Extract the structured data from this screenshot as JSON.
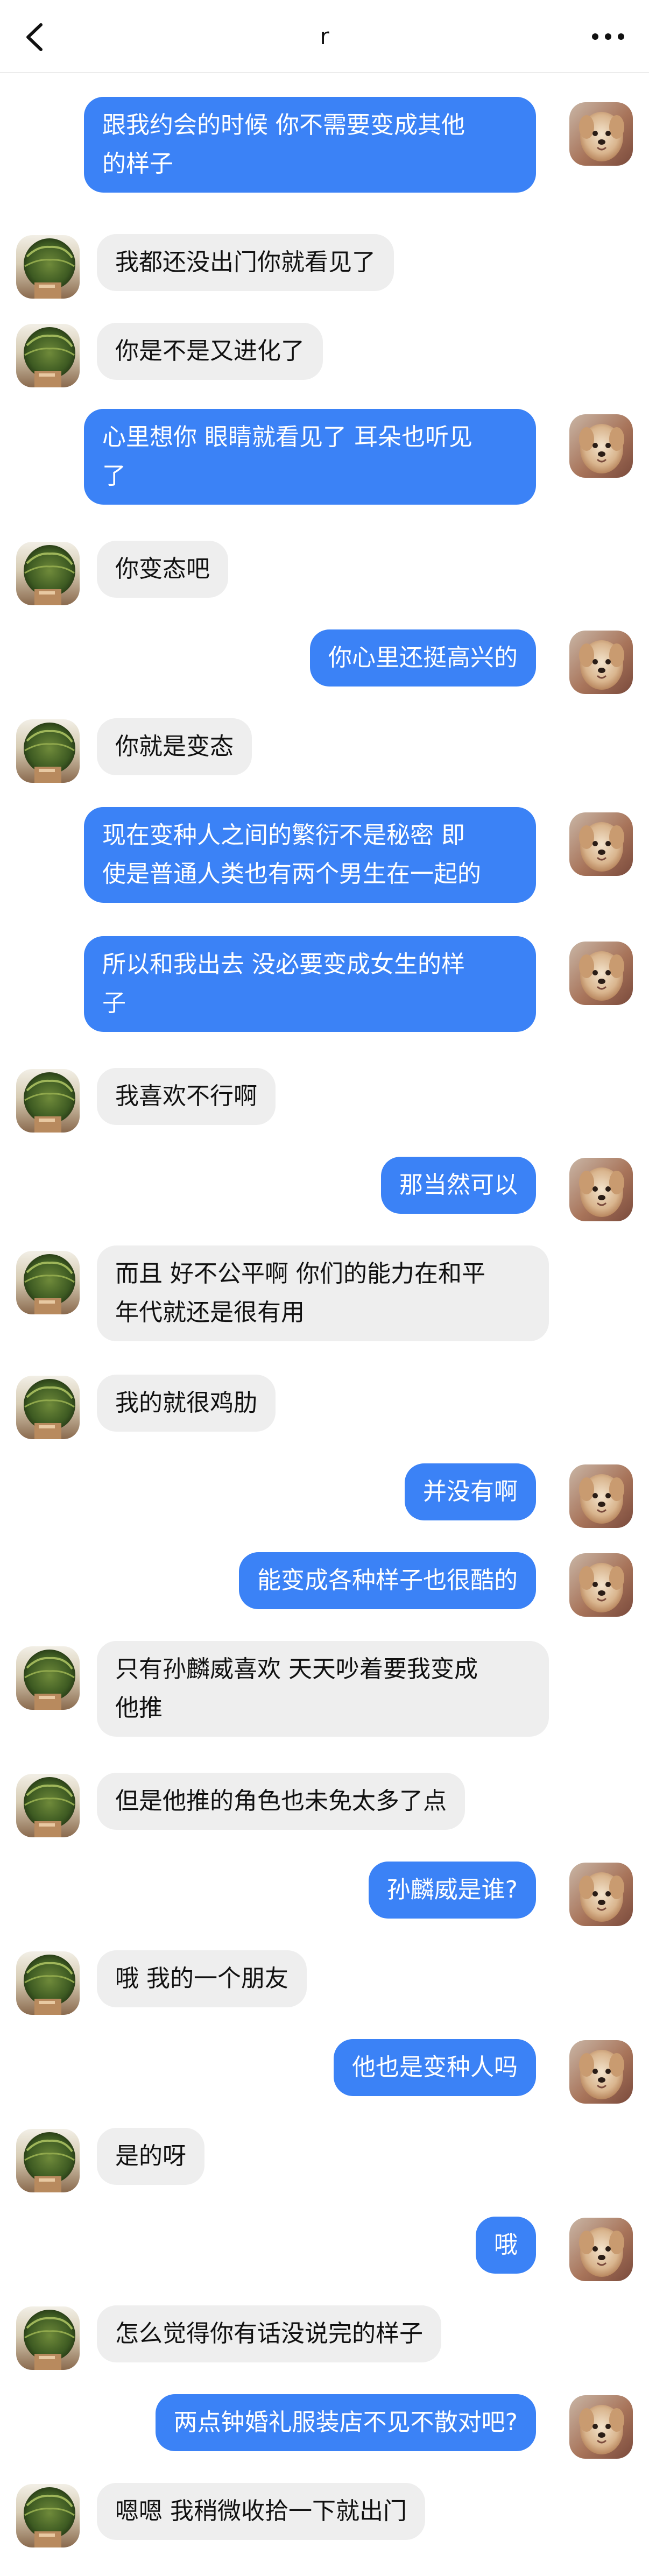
{
  "header": {
    "title": "r",
    "back_icon": "chevron-left-icon",
    "more_icon": "more-horizontal-icon"
  },
  "colors": {
    "outgoing_bubble": "#3b82f6",
    "incoming_bubble": "#eeeeee",
    "outgoing_text": "#ffffff",
    "incoming_text": "#111111"
  },
  "messages": [
    {
      "from": "me",
      "lines": [
        "跟我约会的时候 你不需要变成其他",
        "的样子"
      ]
    },
    {
      "from": "other",
      "lines": [
        "我都还没出门你就看见了"
      ]
    },
    {
      "from": "other",
      "lines": [
        "你是不是又进化了"
      ]
    },
    {
      "from": "me",
      "lines": [
        "心里想你 眼睛就看见了 耳朵也听见",
        "了"
      ]
    },
    {
      "from": "other",
      "lines": [
        "你变态吧"
      ]
    },
    {
      "from": "me",
      "lines": [
        "你心里还挺高兴的"
      ]
    },
    {
      "from": "other",
      "lines": [
        "你就是变态"
      ]
    },
    {
      "from": "me",
      "lines": [
        "现在变种人之间的繁衍不是秘密 即",
        "使是普通人类也有两个男生在一起的"
      ]
    },
    {
      "from": "me",
      "lines": [
        "所以和我出去 没必要变成女生的样",
        "子"
      ]
    },
    {
      "from": "other",
      "lines": [
        "我喜欢不行啊"
      ]
    },
    {
      "from": "me",
      "lines": [
        "那当然可以"
      ]
    },
    {
      "from": "other",
      "lines": [
        "而且 好不公平啊 你们的能力在和平",
        "年代就还是很有用"
      ]
    },
    {
      "from": "other",
      "lines": [
        "我的就很鸡肋"
      ]
    },
    {
      "from": "me",
      "lines": [
        "并没有啊"
      ]
    },
    {
      "from": "me",
      "lines": [
        "能变成各种样子也很酷的"
      ]
    },
    {
      "from": "other",
      "lines": [
        "只有孙麟威喜欢 天天吵着要我变成",
        "他推"
      ]
    },
    {
      "from": "other",
      "lines": [
        "但是他推的角色也未免太多了点"
      ]
    },
    {
      "from": "me",
      "lines": [
        "孙麟威是谁?"
      ]
    },
    {
      "from": "other",
      "lines": [
        "哦 我的一个朋友"
      ]
    },
    {
      "from": "me",
      "lines": [
        "他也是变种人吗"
      ]
    },
    {
      "from": "other",
      "lines": [
        "是的呀"
      ]
    },
    {
      "from": "me",
      "lines": [
        "哦"
      ]
    },
    {
      "from": "other",
      "lines": [
        "怎么觉得你有话没说完的样子"
      ]
    },
    {
      "from": "me",
      "lines": [
        "两点钟婚礼服装店不见不散对吧?"
      ]
    },
    {
      "from": "other",
      "lines": [
        "嗯嗯 我稍微收拾一下就出门"
      ]
    }
  ]
}
